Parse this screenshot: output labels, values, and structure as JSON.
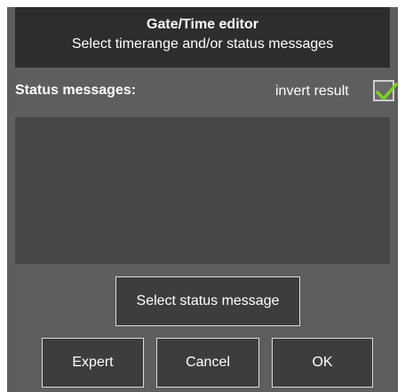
{
  "dialog": {
    "title": "Gate/Time editor",
    "subtitle": "Select timerange and/or status messages"
  },
  "status": {
    "label": "Status messages:",
    "invert_label": "invert result",
    "invert_checked": true,
    "messages": []
  },
  "buttons": {
    "select_status": "Select status message",
    "expert": "Expert",
    "cancel": "Cancel",
    "ok": "OK"
  },
  "colors": {
    "dialog_bg": "#5e5e5e",
    "header_bg": "#2d2d2d",
    "list_bg": "#474747",
    "button_bg": "#3d3d3d",
    "check_green": "#7fd12a"
  },
  "icons": {
    "checkbox_mark": "checkmark-icon"
  }
}
